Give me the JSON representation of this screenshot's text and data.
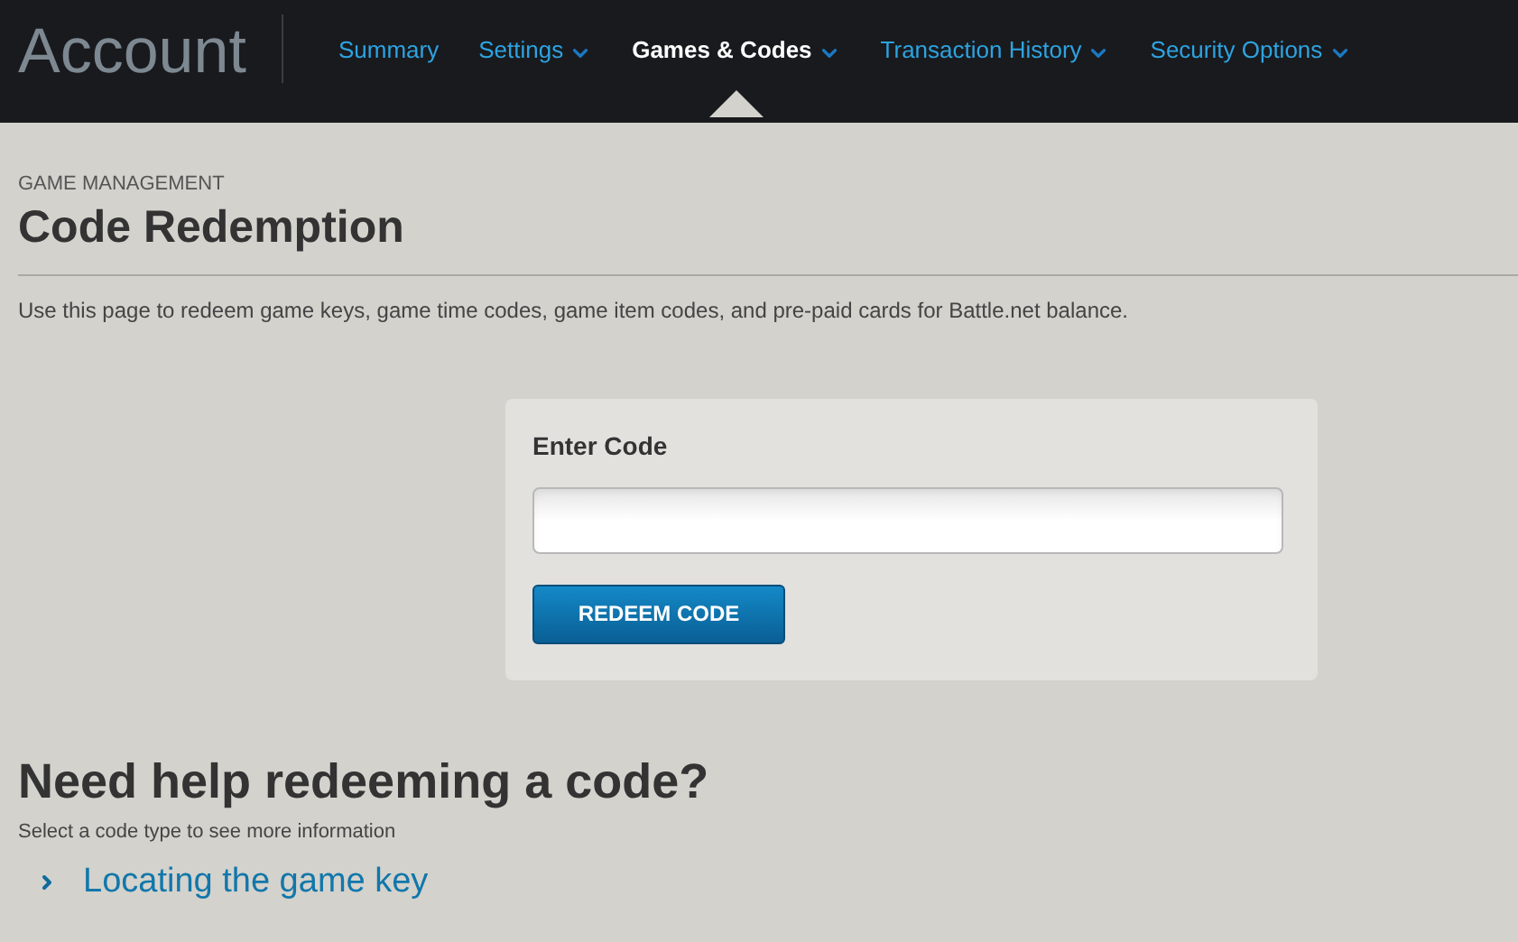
{
  "header": {
    "title": "Account",
    "nav": [
      {
        "label": "Summary",
        "selected": false,
        "dropdown": false
      },
      {
        "label": "Settings",
        "selected": false,
        "dropdown": true
      },
      {
        "label": "Games & Codes",
        "selected": true,
        "dropdown": true
      },
      {
        "label": "Transaction History",
        "selected": false,
        "dropdown": true
      },
      {
        "label": "Security Options",
        "selected": false,
        "dropdown": true
      }
    ]
  },
  "page": {
    "breadcrumb": "GAME MANAGEMENT",
    "title": "Code Redemption",
    "description": "Use this page to redeem game keys, game time codes, game item codes, and pre-paid cards for Battle.net balance."
  },
  "form": {
    "label": "Enter Code",
    "button": "REDEEM CODE"
  },
  "help": {
    "title": "Need help redeeming a code?",
    "subtitle": "Select a code type to see more information",
    "links": [
      "Locating the game key"
    ]
  }
}
